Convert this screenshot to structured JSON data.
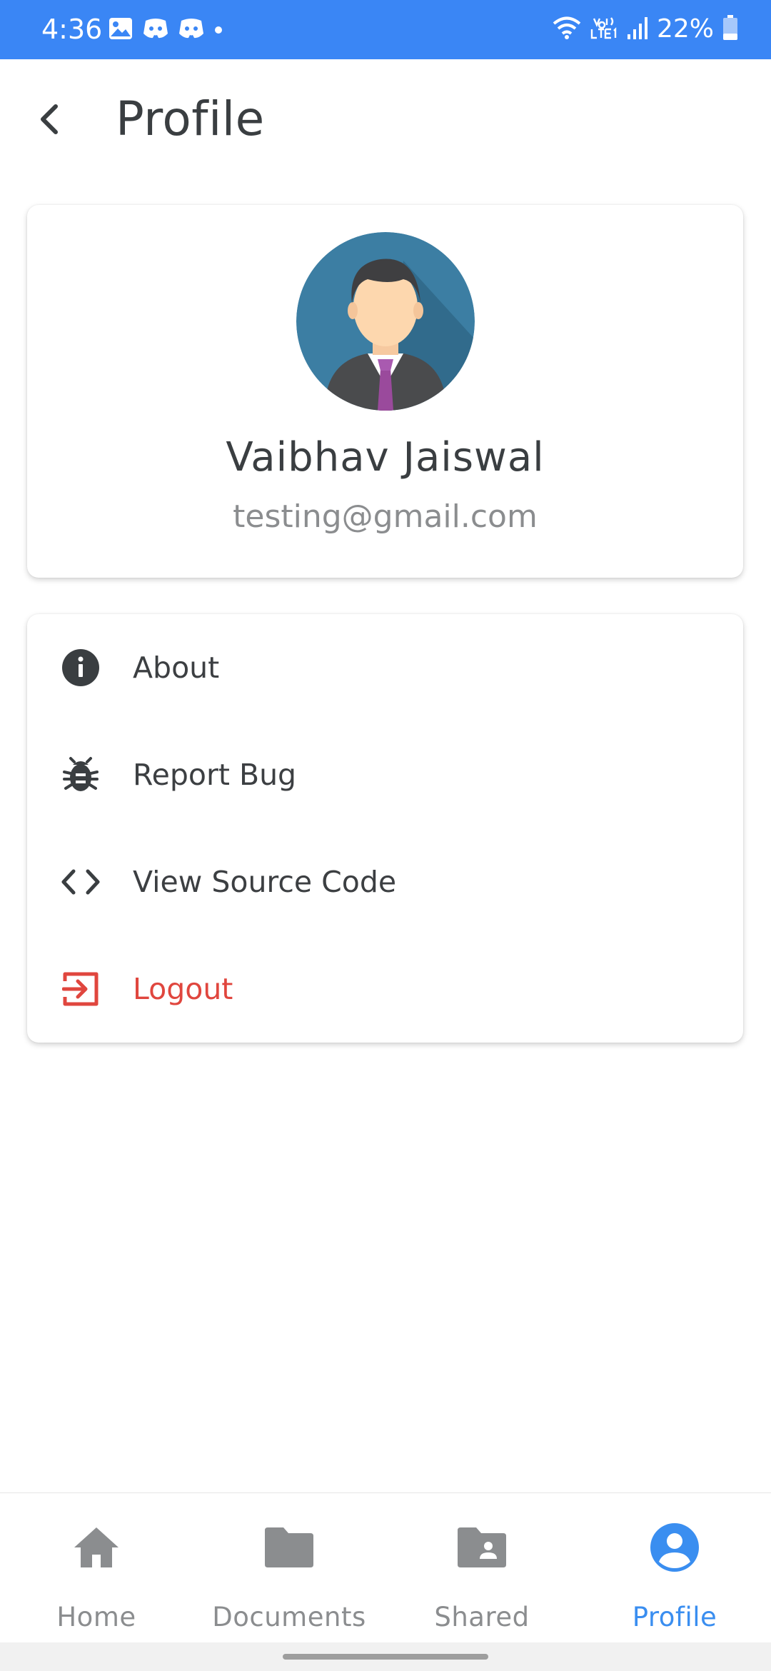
{
  "status_bar": {
    "time": "4:36",
    "battery_text": "22%",
    "background": "#3a86f5",
    "notification_icons": [
      "image-icon",
      "discord-icon",
      "discord-icon",
      "dot-icon"
    ],
    "system_icons": [
      "wifi-icon",
      "volte-icon",
      "signal-icon",
      "battery-icon"
    ]
  },
  "header": {
    "title": "Profile"
  },
  "profile": {
    "name": "Vaibhav Jaiswal",
    "email": "testing@gmail.com"
  },
  "menu": {
    "items": [
      {
        "label": "About",
        "icon": "info-icon"
      },
      {
        "label": "Report Bug",
        "icon": "bug-icon"
      },
      {
        "label": "View Source Code",
        "icon": "code-icon"
      },
      {
        "label": "Logout",
        "icon": "logout-icon",
        "color": "#e0463e"
      }
    ]
  },
  "bottom_nav": {
    "items": [
      {
        "label": "Home",
        "icon": "home-icon"
      },
      {
        "label": "Documents",
        "icon": "folder-icon"
      },
      {
        "label": "Shared",
        "icon": "shared-folder-icon"
      },
      {
        "label": "Profile",
        "icon": "account-circle-icon"
      }
    ],
    "active": "Profile",
    "active_color": "#3a8ef0",
    "inactive_color": "#8b8d8f"
  }
}
